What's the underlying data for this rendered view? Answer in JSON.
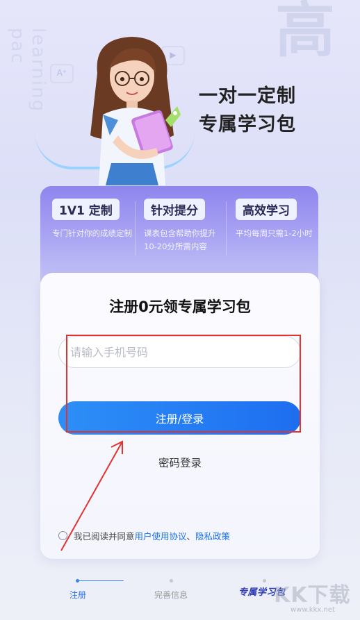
{
  "hero": {
    "title_line1": "一对一定制",
    "title_line2": "专属学习包",
    "deco_letter": "高",
    "deco_vertical": "learning pac"
  },
  "features": [
    {
      "tag": "1V1 定制",
      "desc": "专门针对你的成绩定制"
    },
    {
      "tag": "针对提分",
      "desc": "课表包含帮助你提升10-20分所需内容"
    },
    {
      "tag": "高效学习",
      "desc": "平均每周只需1-2小时"
    }
  ],
  "form": {
    "title": "注册0元领专属学习包",
    "phone_placeholder": "请输入手机号码",
    "phone_value": "",
    "register_label": "注册/登录",
    "password_login_label": "密码登录"
  },
  "agreement": {
    "prefix": "我已阅读并同意",
    "user_agreement": "用户使用协议",
    "separator": "、",
    "privacy_policy": "隐私政策"
  },
  "steps": [
    {
      "label": "注册",
      "active": true
    },
    {
      "label": "完善信息",
      "active": false
    },
    {
      "label": "专属学习包",
      "active": false
    }
  ],
  "watermark": {
    "text": "KK下载",
    "url": "www.kkx.net"
  },
  "colors": {
    "accent": "#1e6ef0",
    "highlight": "#e3322f",
    "link": "#1a6fe8",
    "card_purple": "#8f85ee"
  }
}
